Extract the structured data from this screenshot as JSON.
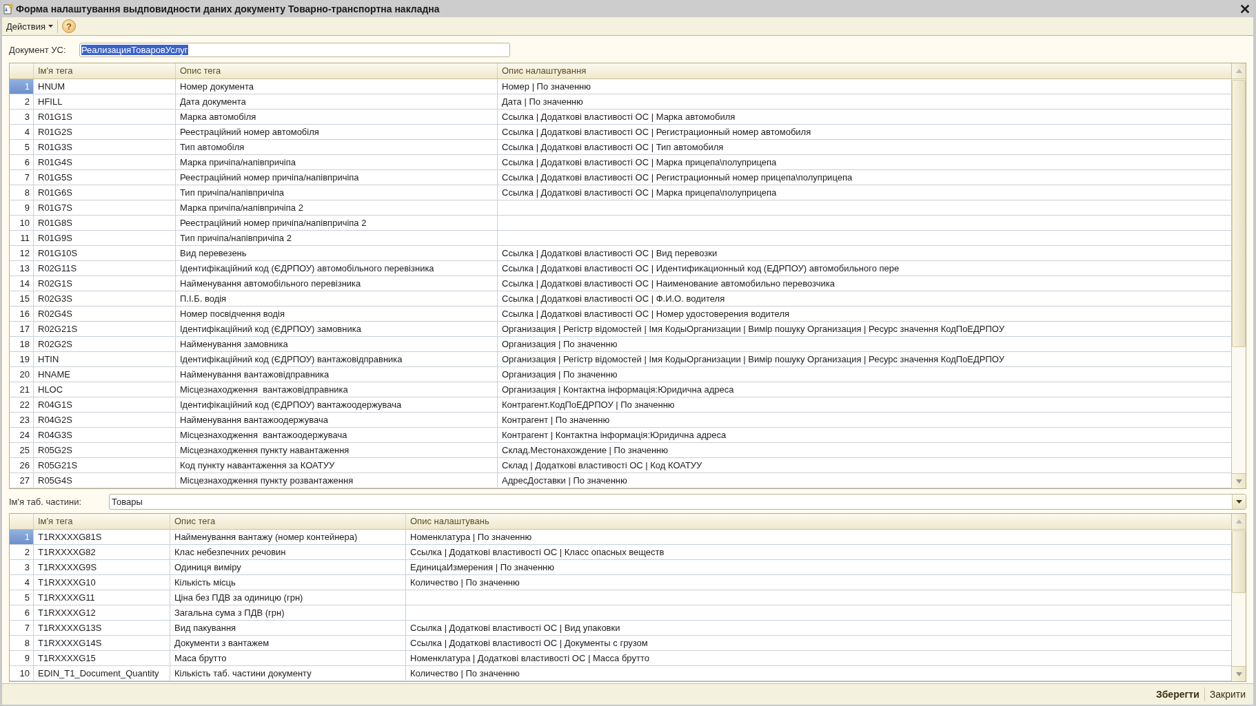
{
  "window": {
    "title": "Форма налаштування выдповидности даних документу Товарно-транспортна накладна"
  },
  "toolbar": {
    "actions_menu": "Действия",
    "help_button": "?"
  },
  "document_field": {
    "label": "Документ УС:",
    "value": "РеализацияТоваровУслуг",
    "text_selected": true
  },
  "header_table": {
    "columns": [
      "Ім'я тега",
      "Опис тега",
      "Опис налаштування"
    ],
    "rows": [
      {
        "number": "1",
        "tag": "HNUM",
        "description": "Номер документа",
        "setting": "Номер | По значенню",
        "selected": true
      },
      {
        "number": "2",
        "tag": "HFILL",
        "description": "Дата документа",
        "setting": "Дата | По значенню",
        "selected": false
      },
      {
        "number": "3",
        "tag": "R01G1S",
        "description": "Марка автомобіля",
        "setting": "Ссылка | Додаткові властивості ОС | Марка автомобиля",
        "selected": false
      },
      {
        "number": "4",
        "tag": "R01G2S",
        "description": "Реестраційний номер автомобіля",
        "setting": "Ссылка | Додаткові властивості ОС | Регистрационный номер автомобиля",
        "selected": false
      },
      {
        "number": "5",
        "tag": "R01G3S",
        "description": "Тип автомобіля",
        "setting": "Ссылка | Додаткові властивості ОС | Тип автомобиля",
        "selected": false
      },
      {
        "number": "6",
        "tag": "R01G4S",
        "description": "Марка причіпа/напівпричіпа",
        "setting": "Ссылка | Додаткові властивості ОС | Марка прицепа\\полуприцепа",
        "selected": false
      },
      {
        "number": "7",
        "tag": "R01G5S",
        "description": "Реестраційний номер причіпа/напівпричіпа",
        "setting": "Ссылка | Додаткові властивості ОС | Регистрационный номер прицепа\\полуприцепа",
        "selected": false
      },
      {
        "number": "8",
        "tag": "R01G6S",
        "description": "Тип причіпа/напівпричіпа",
        "setting": "Ссылка | Додаткові властивості ОС | Марка прицепа\\полуприцепа",
        "selected": false
      },
      {
        "number": "9",
        "tag": "R01G7S",
        "description": "Марка причіпа/напівпричіпа 2",
        "selected": false
      },
      {
        "number": "10",
        "tag": "R01G8S",
        "description": "Реестраційний номер причіпа/напівпричіпа 2",
        "selected": false
      },
      {
        "number": "11",
        "tag": "R01G9S",
        "description": "Тип причіпа/напівпричіпа 2",
        "selected": false
      },
      {
        "number": "12",
        "tag": "R01G10S",
        "description": "Вид перевезень",
        "setting": "Ссылка | Додаткові властивості ОС | Вид перевозки",
        "selected": false
      },
      {
        "number": "13",
        "tag": "R02G11S",
        "description": "Ідентифікаційний код (ЄДРПОУ) автомобільного перевізника",
        "setting": "Ссылка | Додаткові властивості ОС | Идентификационный код (ЕДРПОУ) автомобильного пере",
        "selected": false
      },
      {
        "number": "14",
        "tag": "R02G1S",
        "description": "Найменування автомобільного перевізника",
        "setting": "Ссылка | Додаткові властивості ОС | Наименование автомобильно перевозчика",
        "selected": false
      },
      {
        "number": "15",
        "tag": "R02G3S",
        "description": "П.І.Б. водія",
        "setting": "Ссылка | Додаткові властивості ОС | Ф.И.О. водителя",
        "selected": false
      },
      {
        "number": "16",
        "tag": "R02G4S",
        "description": "Номер посвідчення водія",
        "setting": "Ссылка | Додаткові властивості ОС | Номер удостоверения водителя",
        "selected": false
      },
      {
        "number": "17",
        "tag": "R02G21S",
        "description": "Ідентифікаційний код (ЄДРПОУ) замовника",
        "setting": "Организация | Регістр відомостей | Імя КодыОрганизации | Вимір пошуку Организация | Ресурс значення КодПоЕДРПОУ",
        "selected": false
      },
      {
        "number": "18",
        "tag": "R02G2S",
        "description": "Найменування замовника",
        "setting": "Организация | По значенню",
        "selected": false
      },
      {
        "number": "19",
        "tag": "HTIN",
        "description": "Ідентифікаційний код (ЄДРПОУ) вантажовідправника",
        "setting": "Организация | Регістр відомостей | Імя КодыОрганизации | Вимір пошуку Организация | Ресурс значення КодПоЕДРПОУ",
        "selected": false
      },
      {
        "number": "20",
        "tag": "HNAME",
        "description": "Найменування вантажовідправника",
        "setting": "Организация | По значенню",
        "selected": false
      },
      {
        "number": "21",
        "tag": "HLOC",
        "description": "Місцезнаходження  вантажовідправника",
        "setting": "Организация | Контактна інформація:Юридична адреса",
        "selected": false
      },
      {
        "number": "22",
        "tag": "R04G1S",
        "description": "Ідентифікаційний код (ЄДРПОУ) вантажоодержувача",
        "setting": "Контрагент.КодПоЕДРПОУ | По значенню",
        "selected": false
      },
      {
        "number": "23",
        "tag": "R04G2S",
        "description": "Найменування вантажоодержувача",
        "setting": "Контрагент | По значенню",
        "selected": false
      },
      {
        "number": "24",
        "tag": "R04G3S",
        "description": "Місцезнаходження  вантажоодержувача",
        "setting": "Контрагент | Контактна інформація:Юридична адреса",
        "selected": false
      },
      {
        "number": "25",
        "tag": "R05G2S",
        "description": "Місцезнаходження пункту навантаження",
        "setting": "Склад.Местонахождение | По значенню",
        "selected": false
      },
      {
        "number": "26",
        "tag": "R05G21S",
        "description": "Код пункту навантаження за КОАТУУ",
        "setting": "Склад | Додаткові властивості ОС | Код КОАТУУ",
        "selected": false
      },
      {
        "number": "27",
        "tag": "R05G4S",
        "description": "Місцезнаходження пункту розвантаження",
        "setting": "АдресДоставки | По значенню",
        "selected": false
      }
    ]
  },
  "tab_part_field": {
    "label": "Ім'я таб. частини:",
    "value": "Товары"
  },
  "items_table": {
    "columns": [
      "Ім'я тега",
      "Опис тега",
      "Опис налаштувань"
    ],
    "rows": [
      {
        "number": "1",
        "tag": "T1RXXXXG81S",
        "description": "Найменування вантажу (номер контейнера)",
        "setting": "Номенклатура | По значенню",
        "selected": true
      },
      {
        "number": "2",
        "tag": "T1RXXXXG82",
        "description": "Клас небезпечних речовин",
        "setting": "Ссылка | Додаткові властивості ОС | Класс опасных веществ",
        "selected": false
      },
      {
        "number": "3",
        "tag": "T1RXXXXG9S",
        "description": "Одиниця виміру",
        "setting": "ЕдиницаИзмерения | По значенню",
        "selected": false
      },
      {
        "number": "4",
        "tag": "T1RXXXXG10",
        "description": "Кількість місць",
        "setting": "Количество | По значенню",
        "selected": false
      },
      {
        "number": "5",
        "tag": "T1RXXXXG11",
        "description": "Ціна без ПДВ за одиницю (грн)",
        "selected": false
      },
      {
        "number": "6",
        "tag": "T1RXXXXG12",
        "description": "Загальна сума з ПДВ (грн)",
        "selected": false
      },
      {
        "number": "7",
        "tag": "T1RXXXXG13S",
        "description": "Вид пакування",
        "setting": "Ссылка | Додаткові властивості ОС | Вид упаковки",
        "selected": false
      },
      {
        "number": "8",
        "tag": "T1RXXXXG14S",
        "description": "Документи з вантажем",
        "setting": "Ссылка | Додаткові властивості ОС | Документы с грузом",
        "selected": false
      },
      {
        "number": "9",
        "tag": "T1RXXXXG15",
        "description": "Маса брутто",
        "setting": "Номенклатура | Додаткові властивості ОС | Масса брутто",
        "selected": false
      },
      {
        "number": "10",
        "tag": "EDIN_T1_Document_Quantity",
        "description": "Кількість таб. частини документу",
        "setting": "Количество | По значенню",
        "selected": false
      }
    ]
  },
  "footer": {
    "buttons": [
      {
        "label": "Зберегти",
        "default": true
      },
      {
        "label": "Закрити",
        "default": false
      }
    ]
  }
}
